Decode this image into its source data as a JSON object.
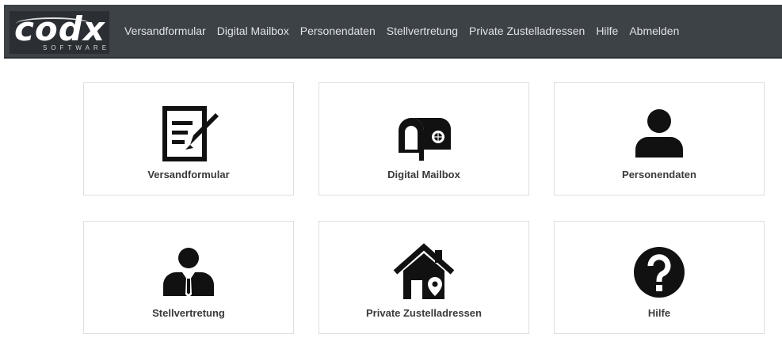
{
  "brand": {
    "name": "codx",
    "sub": "SOFTWARE"
  },
  "nav": {
    "items": [
      "Versandformular",
      "Digital Mailbox",
      "Personendaten",
      "Stellvertretung",
      "Private Zustelladressen",
      "Hilfe",
      "Abmelden"
    ]
  },
  "tiles": [
    {
      "label": "Versandformular",
      "icon": "edit-form-icon"
    },
    {
      "label": "Digital Mailbox",
      "icon": "mailbox-icon"
    },
    {
      "label": "Personendaten",
      "icon": "person-icon"
    },
    {
      "label": "Stellvertretung",
      "icon": "businessman-icon"
    },
    {
      "label": "Private Zustelladressen",
      "icon": "house-location-icon"
    },
    {
      "label": "Hilfe",
      "icon": "help-icon"
    }
  ],
  "colors": {
    "navbar": "#3d4247",
    "icon": "#111111",
    "border": "#dfdfdf"
  }
}
